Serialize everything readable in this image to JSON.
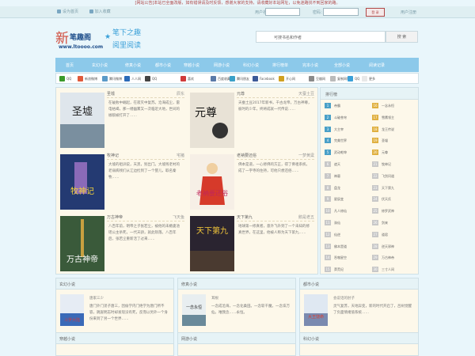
{
  "notice": "[网站公告]本站已全面改版，如有错误请及时反馈，感谢大家的支持，请收藏好本站网址，以免迷路找不到回家的路。",
  "topbar": {
    "links": [
      "设为首页",
      "加入收藏"
    ],
    "user_label": "用户名：",
    "pass_label": "密码：",
    "login_btn": "登 录",
    "register": "用户注册"
  },
  "logo": {
    "big_char": "新",
    "site_name": "笔趣阁",
    "url": "www.ltoooo.com",
    "slogan1": "笔下之趣",
    "slogan2": "阅里阅读"
  },
  "search": {
    "placeholder": "可搜书名和作者",
    "button": "搜 索"
  },
  "nav": [
    "首页",
    "玄幻小说",
    "修真小说",
    "都市小说",
    "穿越小说",
    "网游小说",
    "科幻小说",
    "排行榜单",
    "完本小说",
    "全部小说",
    "阅读记录"
  ],
  "share": [
    {
      "label": "QQ",
      "color": "#3a9a2a"
    },
    {
      "label": "新浪微博",
      "color": "#e05a3a"
    },
    {
      "label": "腾讯微博",
      "color": "#5a9ac8"
    },
    {
      "label": "人人网",
      "color": "#2a6ab8"
    },
    {
      "label": "QQ",
      "color": "#444"
    },
    {
      "label": "喜欢",
      "color": "#d03a3a"
    },
    {
      "label": "百度收藏",
      "color": "#5a7aa8"
    },
    {
      "label": "腾讯朋友",
      "color": "#3aa0c8"
    },
    {
      "label": "Facebook",
      "color": "#3b5998"
    },
    {
      "label": "开心网",
      "color": "#d0a020"
    },
    {
      "label": "豆瓣网",
      "color": "#8a8a8a"
    },
    {
      "label": "复制网址",
      "color": "#bbb"
    },
    {
      "label": "QQ",
      "color": "#3aa0d8"
    },
    {
      "label": "更多",
      "color": "#e8e8e8"
    }
  ],
  "books": [
    {
      "title": "圣墟",
      "author": "辰东",
      "desc": "在破败中崛起，在寂灭中复苏。沧海成尘，雷电枯竭，那一缕幽雾又一次临近大地，世间的枷锁被打开了……",
      "cover": "圣墟"
    },
    {
      "title": "元尊",
      "author": "天蚕土豆",
      "desc": "天蚕土豆2017年新书，千古龙帝，万古神尊，彼时的少年，终将成就一代传说……",
      "cover": "元尊"
    },
    {
      "title": "牧神记",
      "author": "宅猪",
      "desc": "大墟的祖训说，天黑，别出门。大墟残老村的老弱病残们从江边捡到了一个婴儿，取名秦牧……",
      "cover": "牧神记"
    },
    {
      "title": "老衲要还俗",
      "author": "一梦黄粱",
      "desc": "佛本是道，一心修佛的方正，得了佛祖系统，成了一字寺的住持，可他只想还俗……",
      "cover": "老衲要还俗"
    },
    {
      "title": "万古神帝",
      "author": "飞天鱼",
      "desc": "八百年前，明帝之子张若尘，被他的未婚妻池瑶公主杀死，一代天骄，就此陨落。八百年后，张若尘重新活了过来……",
      "cover": "万古神帝"
    },
    {
      "title": "天下第九",
      "author": "鹅是老五",
      "desc": "地球第一修真者，意外飞升到了一个未知的修真世界，在这里，他被人称为天下第九……",
      "cover": "天下第九"
    }
  ],
  "rank": {
    "title": "排行榜",
    "left": [
      "帝霸",
      "斗破苍穹",
      "大主宰",
      "完美世界",
      "武动乾坤",
      "遮天",
      "神墓",
      "盘龙",
      "星辰变",
      "凡人修仙",
      "诛仙",
      "仙逆",
      "佛本是道",
      "吞噬星空",
      "莽荒纪"
    ],
    "right": [
      "一念永恒",
      "雪鹰领主",
      "龙王传说",
      "圣墟",
      "元尊",
      "牧神记",
      "飞剑问道",
      "天下第九",
      "伏天氏",
      "修罗武神",
      "剑来",
      "道君",
      "逆天邪神",
      "万古神帝",
      "三寸人间"
    ]
  },
  "panels": [
    {
      "title": "玄幻小说",
      "book": "斗罗大陆",
      "author": "唐家三少",
      "desc": "唐门外门弟子唐三，因偷学内门绝学为唐门所不容，跳崖明志时却发现没有死，反而以另外一个身份来到了另一个世界……"
    },
    {
      "title": "修真小说",
      "book": "一念永恒",
      "author": "耳根",
      "desc": "一念成沧海，一念化桑田。一念斩千魔，一念诛万仙。唯我念……永恒。"
    },
    {
      "title": "都市小说",
      "book": "大王饶命",
      "author": "会说话的肘子",
      "desc": "灵气复苏，天地异变，新的时代开启了，吕树觉醒了负面情绪值系统……"
    }
  ],
  "panels2": [
    "穿越小说",
    "网游小说",
    "科幻小说"
  ]
}
